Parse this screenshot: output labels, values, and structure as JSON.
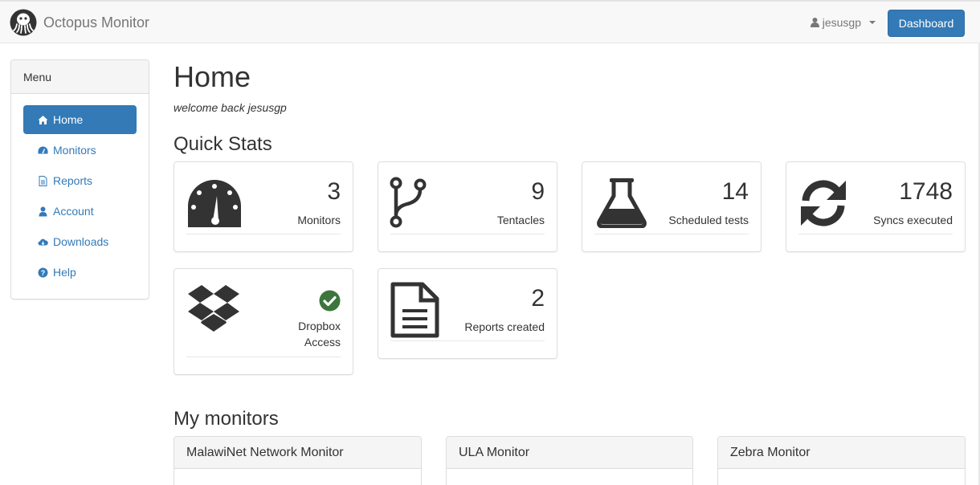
{
  "navbar": {
    "brand": "Octopus Monitor",
    "user": "jesusgp",
    "dashboard_label": "Dashboard"
  },
  "sidebar": {
    "heading": "Menu",
    "items": [
      {
        "label": "Home",
        "icon": "home-icon",
        "active": true
      },
      {
        "label": "Monitors",
        "icon": "dashboard-icon"
      },
      {
        "label": "Reports",
        "icon": "file-icon"
      },
      {
        "label": "Account",
        "icon": "user-icon"
      },
      {
        "label": "Downloads",
        "icon": "cloud-download-icon"
      },
      {
        "label": "Help",
        "icon": "question-circle-icon"
      }
    ]
  },
  "main": {
    "title": "Home",
    "welcome": "welcome back jesusgp",
    "quick_stats_title": "Quick Stats",
    "stats": [
      {
        "value": "3",
        "label": "Monitors",
        "icon": "tachometer-icon"
      },
      {
        "value": "9",
        "label": "Tentacles",
        "icon": "code-fork-icon"
      },
      {
        "value": "14",
        "label": "Scheduled tests",
        "icon": "flask-icon"
      },
      {
        "value": "1748",
        "label": "Syncs executed",
        "icon": "refresh-icon"
      }
    ],
    "dropbox": {
      "label_line1": "Dropbox",
      "label_line2": "Access",
      "icon": "dropbox-icon",
      "status_icon": "check-circle-icon",
      "status_color": "#3c763d"
    },
    "reports": {
      "value": "2",
      "label": "Reports created",
      "icon": "file-text-icon"
    },
    "my_monitors_title": "My monitors",
    "monitors": [
      {
        "name": "MalawiNet Network Monitor"
      },
      {
        "name": "ULA Monitor"
      },
      {
        "name": "Zebra Monitor"
      }
    ]
  },
  "colors": {
    "primary": "#337ab7",
    "icon_dark": "#333333",
    "success": "#3c763d"
  }
}
